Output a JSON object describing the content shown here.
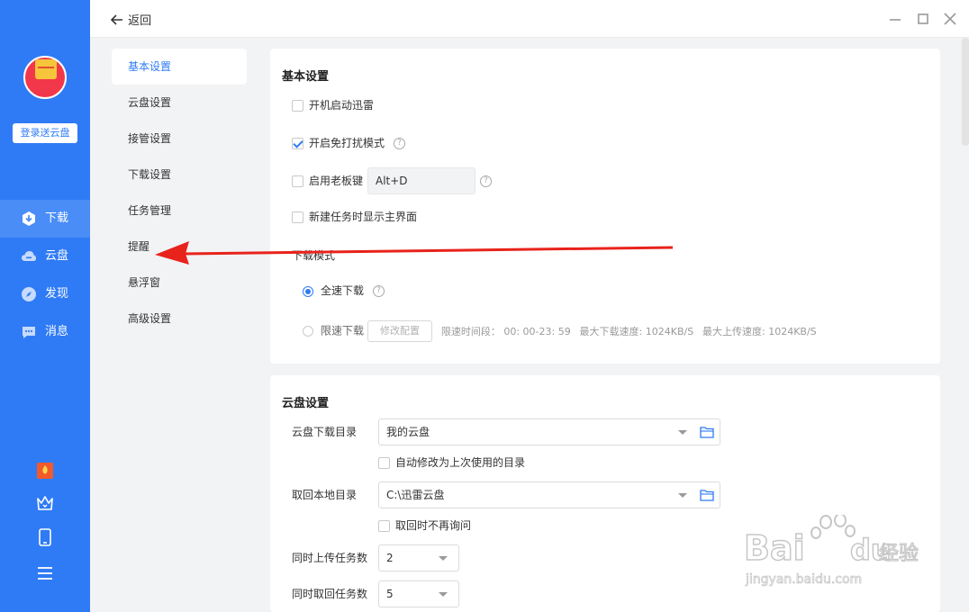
{
  "rail": {
    "login_label": "登录送云盘",
    "items": [
      {
        "label": "下载",
        "icon": "download-icon"
      },
      {
        "label": "云盘",
        "icon": "cloud-icon"
      },
      {
        "label": "发现",
        "icon": "compass-icon"
      },
      {
        "label": "消息",
        "icon": "message-icon"
      }
    ],
    "bottom_icons": [
      "gift-icon",
      "crown-icon",
      "mobile-icon",
      "menu-icon"
    ]
  },
  "topbar": {
    "back_label": "返回"
  },
  "subnav": {
    "items": [
      "基本设置",
      "云盘设置",
      "接管设置",
      "下载设置",
      "任务管理",
      "提醒",
      "悬浮窗",
      "高级设置"
    ],
    "active_index": 0
  },
  "basic": {
    "title": "基本设置",
    "startup_label": "开机启动迅雷",
    "nodisturb_label": "开启免打扰模式",
    "bosskey_label": "启用老板键",
    "bosskey_value": "Alt+D",
    "showmain_label": "新建任务时显示主界面",
    "mode_title": "下载模式",
    "fullspeed_label": "全速下载",
    "limited_label": "限速下载",
    "modify_label": "修改配置",
    "limit_time": "限速时间段： 00: 00-23: 59",
    "max_down": "最大下载速度: 1024KB/S",
    "max_up": "最大上传速度: 1024KB/S",
    "startup_checked": false,
    "nodisturb_checked": true,
    "bosskey_checked": false,
    "showmain_checked": false,
    "mode": "fullspeed"
  },
  "cloud": {
    "title": "云盘设置",
    "dl_dir_label": "云盘下载目录",
    "dl_dir_value": "我的云盘",
    "auto_modify_label": "自动修改为上次使用的目录",
    "local_dir_label": "取回本地目录",
    "local_dir_value": "C:\\迅雷云盘",
    "no_ask_label": "取回时不再询问",
    "upload_tasks_label": "同时上传任务数",
    "upload_tasks_value": "2",
    "fetch_tasks_label": "同时取回任务数",
    "fetch_tasks_value": "5"
  },
  "colors": {
    "accent": "#2f7bf5",
    "annotation": "#e8231b"
  },
  "watermark": {
    "text": "Bai",
    "text2": "du",
    "suffix": "经验",
    "url": "jingyan.baidu.com"
  }
}
